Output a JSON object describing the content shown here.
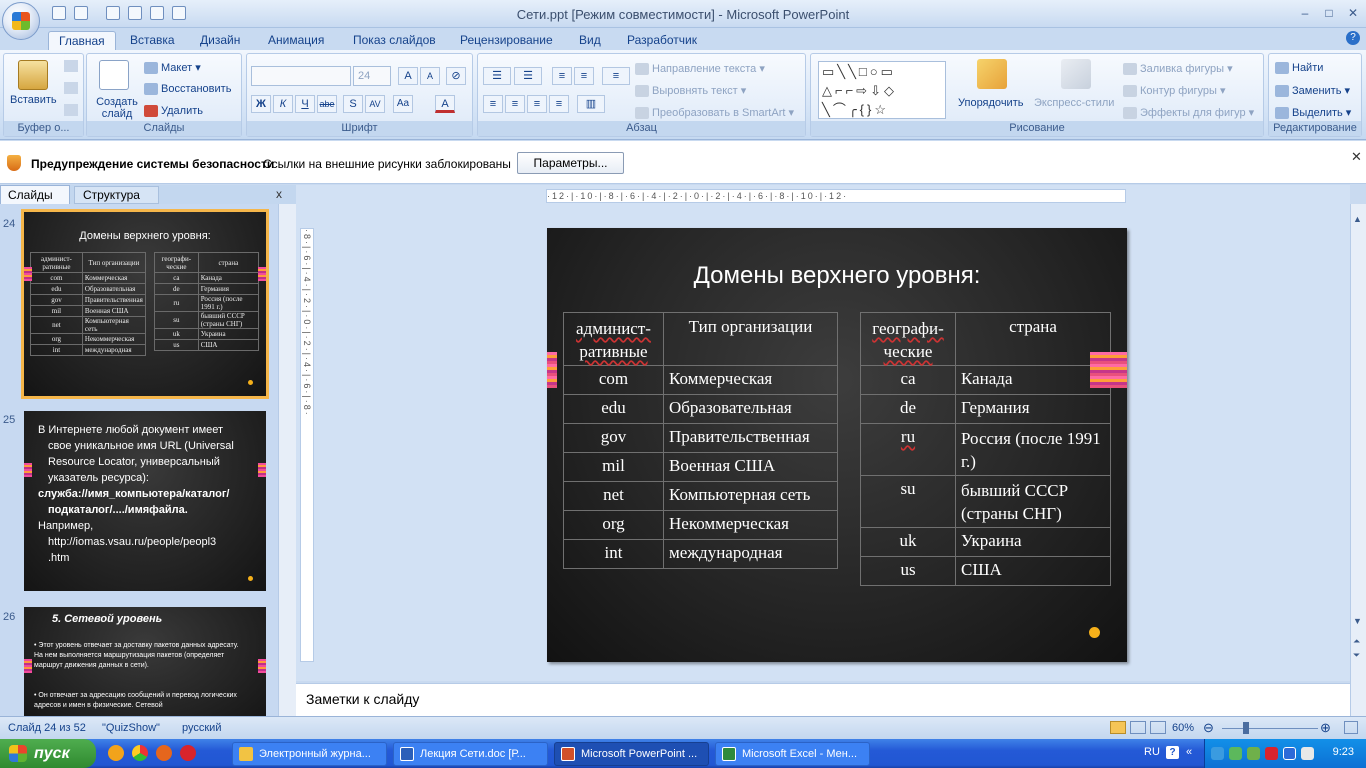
{
  "window": {
    "title": "Сети.ppt [Режим совместимости] - Microsoft PowerPoint",
    "min": "–",
    "max": "□",
    "close": "✕"
  },
  "ribbon": {
    "tabs": [
      "Главная",
      "Вставка",
      "Дизайн",
      "Анимация",
      "Показ слайдов",
      "Рецензирование",
      "Вид",
      "Разработчик"
    ],
    "clipboard": {
      "paste": "Вставить",
      "label": "Буфер о..."
    },
    "slides": {
      "new_slide": "Создать слайд",
      "layout": "Макет",
      "reset": "Восстановить",
      "delete": "Удалить",
      "label": "Слайды"
    },
    "font": {
      "size": "24",
      "bold": "Ж",
      "italic": "К",
      "underline": "Ч",
      "strike": "abe",
      "shadow": "S",
      "spacing": "AV",
      "case": "Aa",
      "color": "A",
      "grow": "A",
      "shrink": "A",
      "label": "Шрифт"
    },
    "paragraph": {
      "text_dir": "Направление текста",
      "align_text": "Выровнять текст",
      "smartart": "Преобразовать в SmartArt",
      "label": "Абзац"
    },
    "drawing": {
      "arrange": "Упорядочить",
      "quick_styles": "Экспресс-стили",
      "fill": "Заливка фигуры",
      "outline": "Контур фигуры",
      "effects": "Эффекты для фигур",
      "label": "Рисование"
    },
    "editing": {
      "find": "Найти",
      "replace": "Заменить",
      "select": "Выделить",
      "label": "Редактирование"
    }
  },
  "security": {
    "title": "Предупреждение системы безопасности",
    "message": "Ссылки на внешние рисунки заблокированы",
    "button": "Параметры...",
    "close": "✕"
  },
  "panel": {
    "tab_slides": "Слайды",
    "tab_outline": "Структура",
    "close": "x"
  },
  "thumbs": [
    {
      "num": "24",
      "title": "Домены верхнего уровня:",
      "left_header": [
        "админист-ративные",
        "Тип организации"
      ],
      "right_header": [
        "географи-ческие",
        "страна"
      ],
      "left_rows": [
        [
          "com",
          "Коммерческая"
        ],
        [
          "edu",
          "Образовательная"
        ],
        [
          "gov",
          "Правительственная"
        ],
        [
          "mil",
          "Военная США"
        ],
        [
          "net",
          "Компьютерная сеть"
        ],
        [
          "org",
          "Некоммерческая"
        ],
        [
          "int",
          "международная"
        ]
      ],
      "right_rows": [
        [
          "ca",
          "Канада"
        ],
        [
          "de",
          "Германия"
        ],
        [
          "ru",
          "Россия (после 1991 г.)"
        ],
        [
          "su",
          "бывший СССР (страны СНГ)"
        ],
        [
          "uk",
          "Украина"
        ],
        [
          "us",
          "США"
        ]
      ]
    },
    {
      "num": "25",
      "lines": [
        "В Интернете любой документ имеет",
        "свое уникальное имя URL (Universal",
        "Resource Locator, универсальный",
        "указатель ресурса):",
        "служба://имя_компьютера/каталог/",
        "подкаталог/..../имяфайла.",
        "Например,",
        "http://iomas.vsau.ru/people/peopl3",
        ".htm"
      ]
    },
    {
      "num": "26",
      "title": "5. Сетевой уровень",
      "bullets": [
        "Этот уровень отвечает за доставку пакетов данных адресату. На нем выполняется маршрутизация пакетов (определяет маршрут движения данных в сети).",
        "Он отвечает за адресацию сообщений и перевод логических адресов и имен в физические. Сетевой"
      ]
    }
  ],
  "ruler": {
    "h": "·12·|·10·|·8·|·6·|·4·|·2·|·0·|·2·|·4·|·6·|·8·|·10·|·12·",
    "v": "·8·|·6·|·4·|·2·|·0·|·2·|·4·|·6·|·8·"
  },
  "slide": {
    "title": "Домены верхнего уровня:",
    "left_header": [
      "админист-ративные",
      "Тип организации"
    ],
    "left_rows": [
      [
        "com",
        "Коммерческая"
      ],
      [
        "edu",
        "Образовательная"
      ],
      [
        "gov",
        "Правительственная"
      ],
      [
        "mil",
        "Военная США"
      ],
      [
        "net",
        "Компьютерная сеть"
      ],
      [
        "org",
        "Некоммерческая"
      ],
      [
        "int",
        "международная"
      ]
    ],
    "right_header": [
      "географи-ческие",
      "страна"
    ],
    "right_rows": [
      [
        "ca",
        "Канада"
      ],
      [
        "de",
        "Германия"
      ],
      [
        "ru",
        "Россия  (после 1991 г.)"
      ],
      [
        "su",
        "бывший СССР (страны СНГ)"
      ],
      [
        "uk",
        "Украина"
      ],
      [
        "us",
        "США"
      ]
    ]
  },
  "notes": {
    "placeholder": "Заметки к слайду"
  },
  "status": {
    "slide": "Слайд 24 из 52",
    "theme": "\"QuizShow\"",
    "lang": "русский",
    "zoom": "60%"
  },
  "taskbar": {
    "start": "пуск",
    "tasks": [
      "Электронный журна...",
      "Лекция Сети.doc [Р...",
      "Microsoft PowerPoint ...",
      "Microsoft Excel - Мен..."
    ],
    "lang": "RU",
    "clock": "9:23"
  },
  "colors": {
    "accent": "#f5b01a",
    "ribbon": "#dbe7f6",
    "slide_bg": "#262626",
    "taskbar": "#2459d6"
  }
}
